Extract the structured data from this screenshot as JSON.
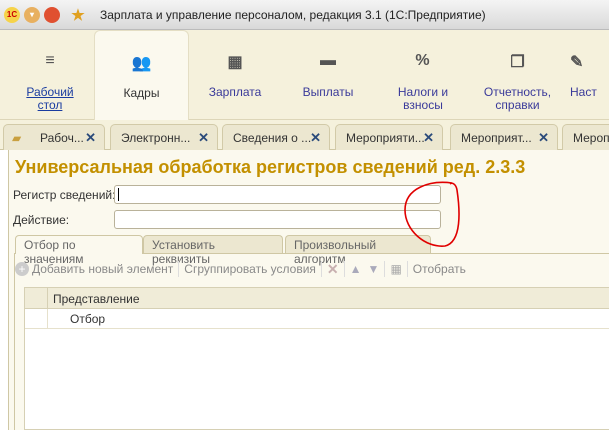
{
  "window": {
    "title": "Зарплата и управление персоналом, редакция 3.1  (1С:Предприятие)",
    "logo": "1С"
  },
  "sections": [
    {
      "label": "Рабочий стол",
      "icon": "menu-icon"
    },
    {
      "label": "Кадры",
      "icon": "users-icon"
    },
    {
      "label": "Зарплата",
      "icon": "calculator-icon"
    },
    {
      "label": "Выплаты",
      "icon": "wallet-icon"
    },
    {
      "label": "Налоги и взносы",
      "icon": "percent-icon"
    },
    {
      "label": "Отчетность, справки",
      "icon": "reports-icon"
    },
    {
      "label": "Наст",
      "icon": "settings-icon"
    }
  ],
  "open_tabs": [
    "Рабоч...",
    "Электронн...",
    "Сведения о ...",
    "Мероприяти...",
    "Мероприят...",
    "Мероприя"
  ],
  "form": {
    "title": "Универсальная обработка регистров сведений ред. 2.3.3",
    "register_label": "Регистр сведений:",
    "register_value": "",
    "action_label": "Действие:",
    "action_value": "",
    "tabs": [
      "Отбор по значениям",
      "Установить реквизиты",
      "Произвольный алгоритм"
    ],
    "toolbar": {
      "add": "Добавить новый элемент",
      "group": "Сгруппировать условия",
      "select": "Отобрать"
    },
    "table": {
      "header": "Представление",
      "rows": [
        "Отбор"
      ]
    }
  },
  "colors": {
    "title": "#c39000",
    "annotation": "#e00000"
  }
}
